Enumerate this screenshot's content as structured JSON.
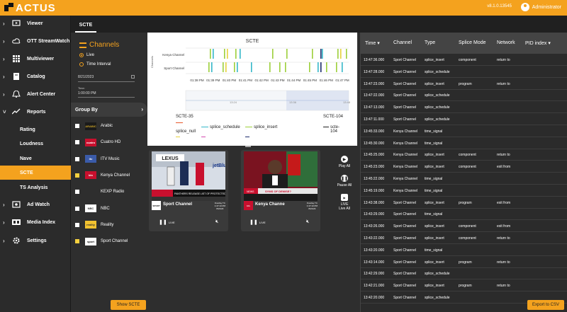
{
  "app": {
    "name": "ACTUS",
    "version": "v8.1.0.13545",
    "user": "Administrator"
  },
  "sidebar": {
    "items": [
      {
        "label": "Viewer",
        "icon": "monitor-icon"
      },
      {
        "label": "OTT StreamWatch",
        "icon": "cloud-icon"
      },
      {
        "label": "Multiviewer",
        "icon": "grid-icon"
      },
      {
        "label": "Catalog",
        "icon": "book-icon"
      },
      {
        "label": "Alert Center",
        "icon": "bell-icon"
      },
      {
        "label": "Reports",
        "icon": "trend-icon"
      },
      {
        "label": "Ad Watch",
        "icon": "adwatch-icon"
      },
      {
        "label": "Media Index",
        "icon": "media-index-icon"
      },
      {
        "label": "Settings",
        "icon": "gear-icon"
      }
    ],
    "report_subitems": [
      "Rating",
      "Loudness",
      "Nave",
      "SCTE",
      "TS Analysis"
    ],
    "active_subitem": "SCTE"
  },
  "tabs": [
    "SCTE"
  ],
  "channels_panel": {
    "title": "Channels",
    "mode_live": "Live",
    "mode_interval": "Time Interval",
    "date": "8/21/2023",
    "time_label": "Time:",
    "time_value": "1:00:00 PM",
    "group_by": "Group By",
    "show_scte": "Show SCTE",
    "channels": [
      {
        "name": "Arabic",
        "checked": false,
        "logo": "ARABIC"
      },
      {
        "name": "Cuatro HD",
        "checked": false,
        "logo": "cuatro"
      },
      {
        "name": "ITV Music",
        "checked": false,
        "logo": "itv"
      },
      {
        "name": "Kenya Channel",
        "checked": true,
        "logo": "ktn"
      },
      {
        "name": "KEXP Radio",
        "checked": false,
        "logo": ""
      },
      {
        "name": "NBC",
        "checked": false,
        "logo": "NBC"
      },
      {
        "name": "Reality",
        "checked": false,
        "logo": "reality"
      },
      {
        "name": "Sport Channel",
        "checked": true,
        "logo": "sport"
      }
    ]
  },
  "scte_chart": {
    "title": "SCTE",
    "y_label": "Channels",
    "channels": [
      "Kenya Channel",
      "Sport Channel"
    ],
    "x_ticks": [
      "01:38 PM",
      "01:39 PM",
      "01:40 PM",
      "01:41 PM",
      "01:42 PM",
      "01:43 PM",
      "01:44 PM",
      "01:45 PM",
      "01:46 PM",
      "01:47 PM"
    ],
    "range_ticks": [
      "13:24",
      "13:36",
      "13:48"
    ],
    "legend_scte35": "SCTE-35",
    "legend_scte104": "SCTE-104",
    "legend_items": [
      {
        "label": "splice_null",
        "color": "#e8572a"
      },
      {
        "label": "splice_schedule",
        "color": "#35b7c9"
      },
      {
        "label": "splice_insert",
        "color": "#9ccf3a"
      },
      {
        "label": "scte-104",
        "color": "#222222"
      }
    ],
    "colors": {
      "kenya_marker": "#35b7c9",
      "insert": "#9ccf3a",
      "schedule": "#35b7c9",
      "null": "#e8572a",
      "dark": "#1c2b6b",
      "yellow": "#e6d33d"
    }
  },
  "players": [
    {
      "name": "Sport Channel",
      "overlay": "Overlay TC",
      "time": "1:47:13 PM",
      "date": "8/21/23",
      "logo": "sport"
    },
    {
      "name": "Kenya Channe",
      "overlay": "Overlay TC",
      "time": "1:47:13 PM",
      "date": "8/21/23",
      "logo": "ktn"
    }
  ],
  "player_controls": {
    "play_all": "Play All",
    "pause_all": "Pause All",
    "live_all": "Live All",
    "live_badge": "LIVE"
  },
  "table": {
    "columns": [
      "Time",
      "Channel",
      "Type",
      "Splice Mode",
      "Network",
      "PID index"
    ],
    "rows": [
      [
        "13:47:36.000",
        "Sport Channel",
        "splice_insert",
        "component",
        "return to",
        ""
      ],
      [
        "13:47:28.000",
        "Sport Channel",
        "splice_schedule",
        "",
        "",
        ""
      ],
      [
        "13:47:23.000",
        "Sport Channel",
        "splice_insert",
        "program",
        "return to",
        ""
      ],
      [
        "13:47:22.000",
        "Sport Channel",
        "splice_schedule",
        "",
        "",
        ""
      ],
      [
        "13:47:13.000",
        "Sport Channel",
        "splice_schedule",
        "",
        "",
        ""
      ],
      [
        "13:47:11.000",
        "Sport Channel",
        "splice_schedule",
        "",
        "",
        ""
      ],
      [
        "13:45:33.000",
        "Kenya Channel",
        "time_signal",
        "",
        "",
        ""
      ],
      [
        "13:45:30.000",
        "Kenya Channel",
        "time_signal",
        "",
        "",
        ""
      ],
      [
        "13:45:25.000",
        "Kenya Channel",
        "splice_insert",
        "component",
        "return to",
        ""
      ],
      [
        "13:45:23.000",
        "Kenya Channel",
        "splice_insert",
        "component",
        "exit from",
        ""
      ],
      [
        "13:45:22.000",
        "Kenya Channel",
        "time_signal",
        "",
        "",
        ""
      ],
      [
        "13:45:19.000",
        "Kenya Channel",
        "time_signal",
        "",
        "",
        ""
      ],
      [
        "13:43:38.000",
        "Sport Channel",
        "splice_insert",
        "program",
        "exit from",
        ""
      ],
      [
        "13:43:29.000",
        "Sport Channel",
        "time_signal",
        "",
        "",
        ""
      ],
      [
        "13:43:26.000",
        "Sport Channel",
        "splice_insert",
        "component",
        "exit from",
        ""
      ],
      [
        "13:43:22.000",
        "Sport Channel",
        "splice_insert",
        "component",
        "return to",
        ""
      ],
      [
        "13:43:20.000",
        "Sport Channel",
        "time_signal",
        "",
        "",
        ""
      ],
      [
        "13:43:14.000",
        "Sport Channel",
        "splice_insert",
        "program",
        "return to",
        ""
      ],
      [
        "13:42:29.000",
        "Sport Channel",
        "splice_schedule",
        "",
        "",
        ""
      ],
      [
        "13:42:21.000",
        "Sport Channel",
        "splice_insert",
        "program",
        "return to",
        ""
      ],
      [
        "13:42:20.000",
        "Sport Channel",
        "splice_schedule",
        "",
        "",
        ""
      ]
    ],
    "export_label": "Export to CSV"
  }
}
